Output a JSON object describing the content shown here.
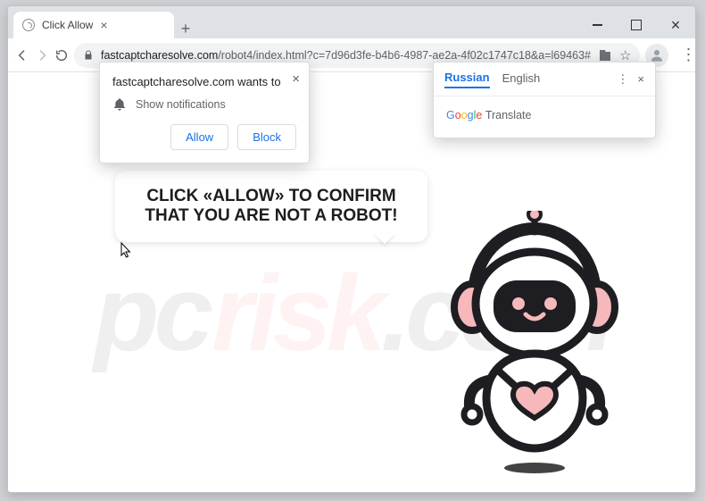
{
  "tab": {
    "title": "Click Allow"
  },
  "url": {
    "host": "fastcaptcharesolve.com",
    "path": "/robot4/index.html?c=7d96d3fe-b4b6-4987-ae2a-4f02c1747c18&a=l69463#"
  },
  "notification": {
    "wants_to": "fastcaptcharesolve.com wants to",
    "permission": "Show notifications",
    "allow": "Allow",
    "block": "Block"
  },
  "translate": {
    "tab_russian": "Russian",
    "tab_english": "English",
    "brand": "Google",
    "product": "Translate"
  },
  "speech": {
    "text": "CLICK «ALLOW» TO CONFIRM THAT YOU ARE NOT A ROBOT!"
  },
  "watermark": {
    "a": "pc",
    "b": "risk",
    "c": ".com"
  }
}
